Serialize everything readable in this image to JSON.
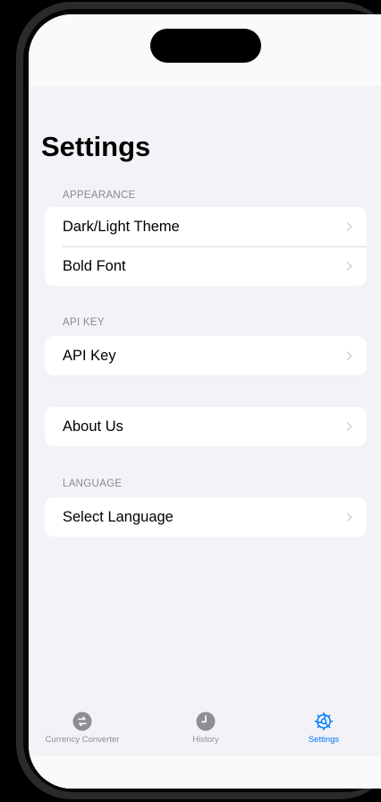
{
  "page": {
    "title": "Settings"
  },
  "sections": [
    {
      "header": "APPEARANCE",
      "rows": [
        {
          "label": "Dark/Light Theme"
        },
        {
          "label": "Bold Font"
        }
      ]
    },
    {
      "header": "API KEY",
      "rows": [
        {
          "label": "API Key"
        }
      ]
    },
    {
      "header": "",
      "rows": [
        {
          "label": "About Us"
        }
      ]
    },
    {
      "header": "LANGUAGE",
      "rows": [
        {
          "label": "Select Language"
        }
      ]
    }
  ],
  "tabbar": {
    "items": [
      {
        "label": "Currency Converter",
        "icon": "currency-exchange-icon",
        "active": false
      },
      {
        "label": "History",
        "icon": "clock-icon",
        "active": false
      },
      {
        "label": "Settings",
        "icon": "gear-icon",
        "active": true
      }
    ]
  },
  "colors": {
    "accent": "#007aff",
    "background": "#f2f2f7",
    "inactive": "#8e8e93"
  }
}
